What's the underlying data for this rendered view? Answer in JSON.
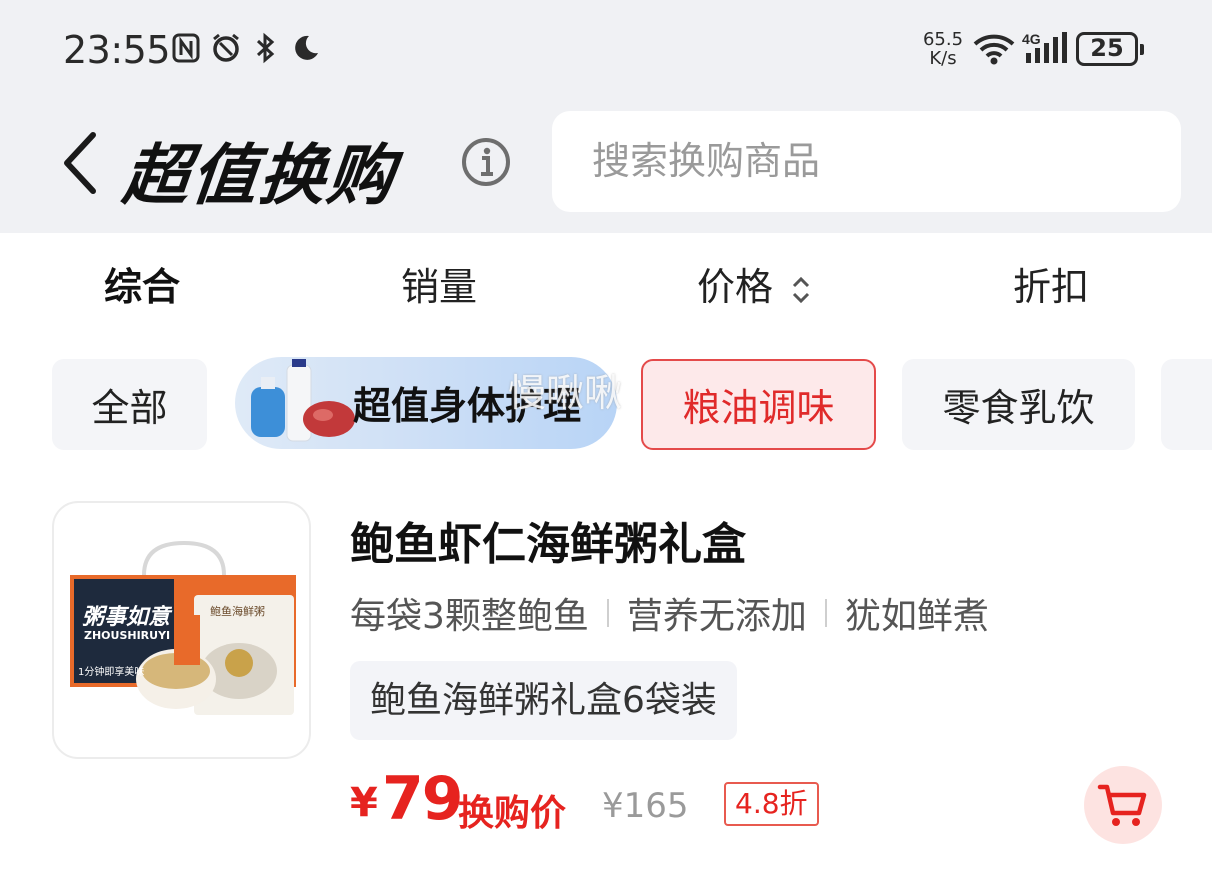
{
  "status_bar": {
    "time": "23:55",
    "net_speed_value": "65.5",
    "net_speed_unit": "K/s",
    "network_type": "4G",
    "battery": "25"
  },
  "header": {
    "title": "超值换购",
    "search_placeholder": "搜索换购商品"
  },
  "sort_tabs": [
    {
      "label": "综合",
      "active": true
    },
    {
      "label": "销量",
      "active": false
    },
    {
      "label": "价格",
      "active": false
    },
    {
      "label": "折扣",
      "active": false
    }
  ],
  "categories": {
    "all": "全部",
    "promo_banner": "超值身体护理",
    "grain_oil": "粮油调味",
    "snacks": "零食乳饮"
  },
  "watermark": "慢啾啾",
  "product": {
    "title": "鲍鱼虾仁海鲜粥礼盒",
    "features": [
      "每袋3颗整鲍鱼",
      "营养无添加",
      "犹如鲜煮"
    ],
    "spec": "鲍鱼海鲜粥礼盒6袋装",
    "price_symbol": "¥",
    "price": "79",
    "price_label": "换购价",
    "original_price": "¥165",
    "discount": "4.8折",
    "box_text_main": "粥事如意",
    "box_text_sub": "ZHOUSHIRUYI",
    "box_slogan": "1分钟即享美味",
    "pouch_text": "鲍鱼海鲜粥"
  },
  "colors": {
    "accent_red": "#e6231f",
    "header_bg": "#f0f1f4",
    "chip_bg": "#f4f5f8",
    "active_chip_bg": "#fde9ea"
  }
}
